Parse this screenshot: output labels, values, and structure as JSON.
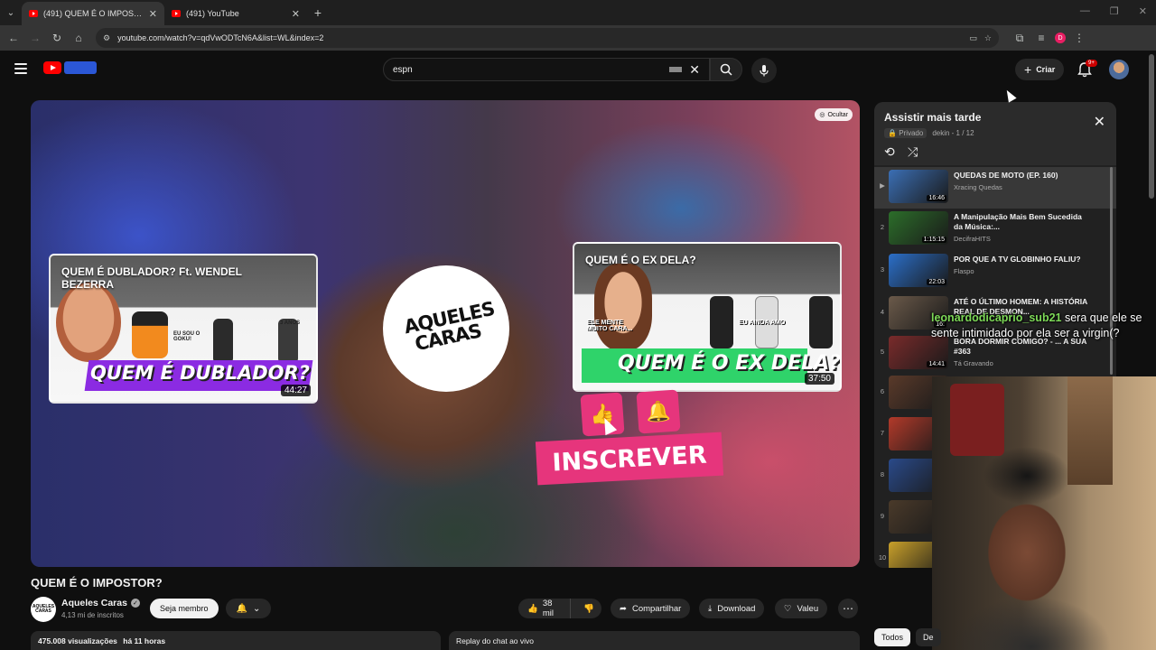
{
  "browser": {
    "tabs": [
      {
        "title": "(491) QUEM É O IMPOSTOR? - YouTube",
        "active": true
      },
      {
        "title": "(491) YouTube",
        "active": false
      }
    ],
    "new_tab_icon": "plus-icon",
    "url": "youtube.com/watch?v=qdVwODTcN6A&list=WL&index=2",
    "profile_initial": "D"
  },
  "header": {
    "search_value": "espn",
    "create_label": "Criar",
    "notification_count": "9+"
  },
  "player": {
    "hide_label": "Ocultar",
    "logo_text": "AQUELES CARAS",
    "subscribe_overlay": "INSCREVER",
    "endcards": [
      {
        "title": "QUEM É DUBLADOR? Ft. WENDEL BEZERRA",
        "banner": "QUEM É DUBLADOR?",
        "duration": "44:27",
        "caption_1": "EU SOU O GOKU!",
        "caption_2": "3 ANOS"
      },
      {
        "title": "QUEM É O EX DELA?",
        "banner": "QUEM É O EX DELA?",
        "duration": "37:50",
        "caption_1": "ELE MENTE MUITO CARA...",
        "caption_2": "EU AINDA AMO"
      }
    ]
  },
  "video": {
    "title": "QUEM É O IMPOSTOR?",
    "channel": "Aqueles Caras",
    "subscribers": "4,13 mi de inscritos",
    "member_label": "Seja membro",
    "likes": "38 mil",
    "share_label": "Compartilhar",
    "download_label": "Download",
    "thanks_label": "Valeu",
    "views": "475.008 visualizações",
    "time_ago": "há 11 horas",
    "replay_label": "Replay do chat ao vivo"
  },
  "playlist": {
    "title": "Assistir mais tarde",
    "privacy": "Privado",
    "owner_position": "dekin - 1 / 12",
    "items": [
      {
        "index": "▶",
        "title": "QUEDAS DE MOTO (EP. 160)",
        "channel": "Xracing Quedas",
        "duration": "16:46",
        "color": "#3b6fb5"
      },
      {
        "index": "2",
        "title": "A Manipulação Mais Bem Sucedida da Música:...",
        "channel": "DecifraHITS",
        "duration": "1:15:15",
        "color": "#2c6e2a"
      },
      {
        "index": "3",
        "title": "POR QUE A TV GLOBINHO FALIU?",
        "channel": "Flaspo",
        "duration": "22:03",
        "color": "#2b6fc9"
      },
      {
        "index": "4",
        "title": "ATÉ O ÚLTIMO HOMEM: A HISTÓRIA REAL DE DESMON...",
        "channel": "",
        "duration": "16:",
        "color": "#6b5a4a"
      },
      {
        "index": "5",
        "title": "BORA DORMIR COMIGO? - ... A SUA #363",
        "channel": "Tá Gravando",
        "duration": "14:41",
        "color": "#7a2b2b"
      },
      {
        "index": "6",
        "title": "",
        "channel": "",
        "duration": "34",
        "color": "#5a3a2a"
      },
      {
        "index": "7",
        "title": "",
        "channel": "",
        "duration": "20",
        "color": "#b33a2a"
      },
      {
        "index": "8",
        "title": "",
        "channel": "",
        "duration": "10",
        "color": "#2a4a8a"
      },
      {
        "index": "9",
        "title": "",
        "channel": "",
        "duration": "1:0",
        "color": "#4a3a2a"
      },
      {
        "index": "10",
        "title": "",
        "channel": "",
        "duration": "",
        "color": "#c9a02a"
      }
    ]
  },
  "chat": {
    "user": "leonardodicaprio_sub21",
    "message": "sera que ele se sente intimidado por ela ser a virgin(?"
  },
  "chips": {
    "all": "Todos",
    "second": "De"
  }
}
